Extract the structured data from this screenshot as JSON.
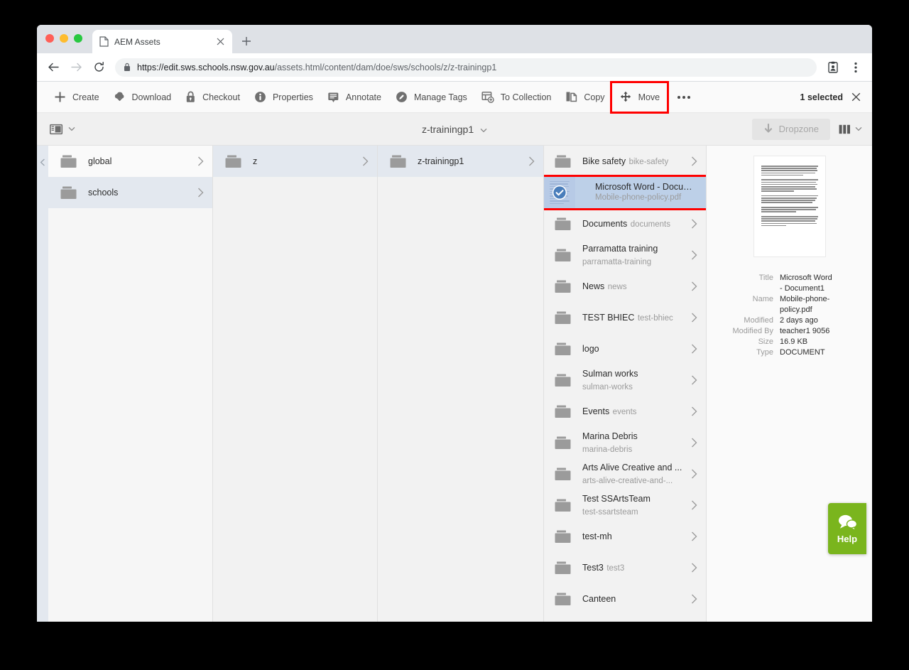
{
  "browser": {
    "tab": {
      "title": "AEM Assets",
      "favicon_icon": "document-icon",
      "close_icon": "close-icon"
    },
    "newtab_icon": "plus-icon",
    "back_icon": "arrow-left-icon",
    "forward_icon": "arrow-right-icon",
    "reload_icon": "reload-icon",
    "lock_icon": "lock-icon",
    "url_domain": "https://edit.sws.schools.nsw.gov.au",
    "url_path": "/assets.html/content/dam/doe/sws/schools/z/z-trainingp1",
    "profile_icon": "profile-card-icon",
    "menu_icon": "kebab-menu-icon"
  },
  "toolbar": {
    "items": [
      {
        "label": "Create",
        "icon": "plus-icon"
      },
      {
        "label": "Download",
        "icon": "download-cloud-icon"
      },
      {
        "label": "Checkout",
        "icon": "lock-icon"
      },
      {
        "label": "Properties",
        "icon": "info-icon"
      },
      {
        "label": "Annotate",
        "icon": "annotate-icon"
      },
      {
        "label": "Manage Tags",
        "icon": "tag-pen-icon"
      },
      {
        "label": "To Collection",
        "icon": "collection-add-icon"
      },
      {
        "label": "Copy",
        "icon": "copy-icon"
      },
      {
        "label": "Move",
        "icon": "move-arrows-icon",
        "highlighted": true
      }
    ],
    "more_label": "•••",
    "more_icon": "ellipsis-icon",
    "selection_label": "1 selected",
    "clear_selection_icon": "close-icon",
    "highlight_color": "#ff0000"
  },
  "subbar": {
    "rail_toggle_icon": "rail-panel-icon",
    "rail_chevron_icon": "chevron-down-icon",
    "breadcrumb_title": "z-trainingp1",
    "breadcrumb_chevron_icon": "chevron-down-icon",
    "dropzone_label": "Dropzone",
    "dropzone_icon": "download-arrow-icon",
    "view_icon": "columns-view-icon",
    "view_chevron_icon": "chevron-down-icon"
  },
  "columns": {
    "rail_arrow_icon": "chevron-left-icon",
    "col1": [
      {
        "title": "global",
        "subtitle": "",
        "state": "light",
        "icon": "folder-icon",
        "chevron": "chevron-right-icon"
      },
      {
        "title": "schools",
        "subtitle": "",
        "state": "active",
        "icon": "folder-icon",
        "chevron": "chevron-right-icon"
      }
    ],
    "col2": [
      {
        "title": "z",
        "subtitle": "",
        "state": "active",
        "icon": "folder-icon",
        "chevron": "chevron-right-icon"
      }
    ],
    "col3": [
      {
        "title": "z-trainingp1",
        "subtitle": "",
        "state": "active",
        "icon": "folder-icon",
        "chevron": "chevron-right-icon"
      }
    ],
    "col4": [
      {
        "title": "Bike safety",
        "subtitle": "bike-safety",
        "type": "folder",
        "icon": "folder-icon",
        "chevron": "chevron-right-icon"
      },
      {
        "title": "Microsoft Word - Document1",
        "subtitle": "Mobile-phone-policy.pdf",
        "type": "asset",
        "icon": "checkmark-circle-icon",
        "selected": true,
        "highlighted": true
      },
      {
        "title": "Documents",
        "subtitle": "documents",
        "type": "folder",
        "icon": "folder-icon",
        "chevron": "chevron-right-icon"
      },
      {
        "title": "Parramatta training",
        "subtitle": "parramatta-training",
        "type": "folder",
        "icon": "folder-icon",
        "chevron": "chevron-right-icon"
      },
      {
        "title": "News",
        "subtitle": "news",
        "type": "folder",
        "icon": "folder-icon",
        "chevron": "chevron-right-icon"
      },
      {
        "title": "TEST BHIEC",
        "subtitle": "test-bhiec",
        "type": "folder",
        "icon": "folder-icon",
        "chevron": "chevron-right-icon"
      },
      {
        "title": "logo",
        "subtitle": "",
        "type": "folder",
        "icon": "folder-icon",
        "chevron": "chevron-right-icon"
      },
      {
        "title": "Sulman works",
        "subtitle": "sulman-works",
        "type": "folder",
        "icon": "folder-icon",
        "chevron": "chevron-right-icon"
      },
      {
        "title": "Events",
        "subtitle": "events",
        "type": "folder",
        "icon": "folder-icon",
        "chevron": "chevron-right-icon"
      },
      {
        "title": "Marina Debris",
        "subtitle": "marina-debris",
        "type": "folder",
        "icon": "folder-icon",
        "chevron": "chevron-right-icon"
      },
      {
        "title": "Arts Alive Creative and ...",
        "subtitle": "arts-alive-creative-and-...",
        "type": "folder",
        "icon": "folder-icon",
        "chevron": "chevron-right-icon"
      },
      {
        "title": "Test SSArtsTeam",
        "subtitle": "test-ssartsteam",
        "type": "folder",
        "icon": "folder-icon",
        "chevron": "chevron-right-icon"
      },
      {
        "title": "test-mh",
        "subtitle": "",
        "type": "folder",
        "icon": "folder-icon",
        "chevron": "chevron-right-icon"
      },
      {
        "title": "Test3",
        "subtitle": "test3",
        "type": "folder",
        "icon": "folder-icon",
        "chevron": "chevron-right-icon"
      },
      {
        "title": "Canteen",
        "subtitle": "",
        "type": "folder",
        "icon": "folder-icon",
        "chevron": "chevron-right-icon"
      }
    ]
  },
  "preview": {
    "thumbnail_alt": "document-page-thumbnail",
    "fields": [
      {
        "key": "Title",
        "value": "Microsoft Word - Document1"
      },
      {
        "key": "Name",
        "value": "Mobile-phone-policy.pdf"
      },
      {
        "key": "Modified",
        "value": "2 days ago"
      },
      {
        "key": "Modified By",
        "value": "teacher1 9056"
      },
      {
        "key": "Size",
        "value": "16.9 KB"
      },
      {
        "key": "Type",
        "value": "DOCUMENT"
      }
    ]
  },
  "help": {
    "label": "Help",
    "icon": "chat-bubbles-icon",
    "color": "#7ab51d"
  }
}
